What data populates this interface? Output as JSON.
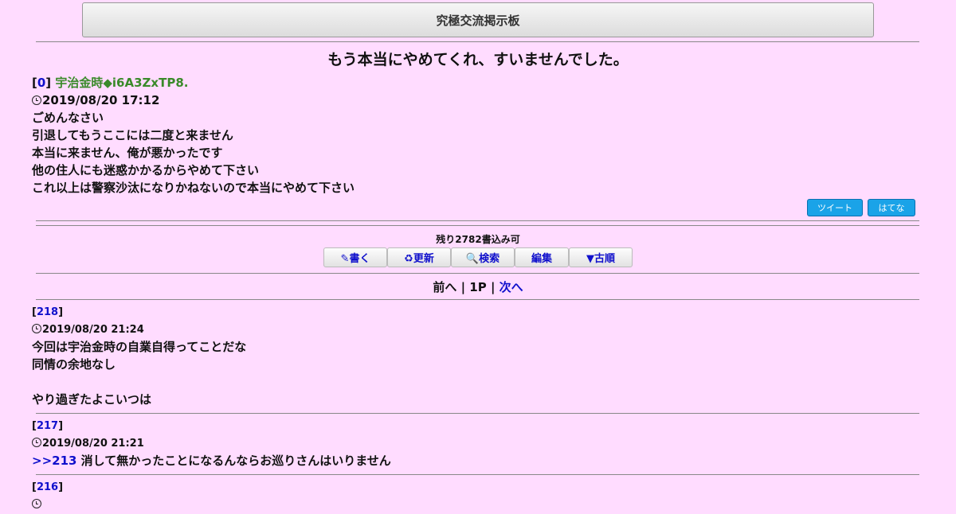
{
  "board": {
    "title": "究極交流掲示板"
  },
  "thread": {
    "title": "もう本当にやめてくれ、すいませんでした。",
    "op": {
      "number": "0",
      "name": "宇治金時◆i6A3ZxTP8.",
      "date": "2019/08/20 17:12",
      "lines": [
        "ごめんなさい",
        "引退してもうここには二度と来ません",
        "本当に来ません、俺が悪かったです",
        "他の住人にも迷惑かかるからやめて下さい",
        "これ以上は警察沙汰になりかねないので本当にやめて下さい"
      ]
    }
  },
  "share": {
    "tweet_label": "ツイート",
    "hatena_label": "はてな"
  },
  "remaining": "残り2782書込み可",
  "toolbar": {
    "write": "✎書く",
    "refresh": "♻更新",
    "search": "🔍検索",
    "edit": "編集",
    "order": "▼古順"
  },
  "pager": {
    "prev": "前へ",
    "sep1": "|",
    "page": "1P",
    "sep2": "|",
    "next": "次へ"
  },
  "posts": [
    {
      "number": "218",
      "date": "2019/08/20 21:24",
      "lines": [
        "今回は宇治金時の自業自得ってことだな",
        "同情の余地なし",
        "",
        "やり過ぎたよこいつは"
      ]
    },
    {
      "number": "217",
      "date": "2019/08/20 21:21",
      "anchor": ">>213",
      "text": " 消して無かったことになるんならお巡りさんはいりません"
    },
    {
      "number": "216"
    }
  ],
  "icons": {
    "clock": "clock-icon"
  }
}
